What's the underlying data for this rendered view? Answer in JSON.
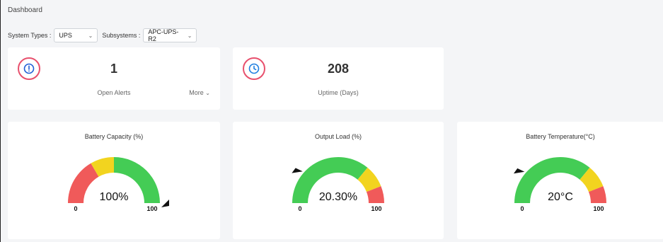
{
  "page": {
    "title": "Dashboard"
  },
  "filters": {
    "system_types_label": "System Types :",
    "system_types_value": "UPS",
    "subsystems_label": "Subsystems :",
    "subsystems_value": "APC-UPS-R2"
  },
  "stats": [
    {
      "icon": "alert-circle-icon",
      "value": "1",
      "label": "Open Alerts",
      "more_label": "More"
    },
    {
      "icon": "clock-icon",
      "value": "208",
      "label": "Uptime (Days)"
    }
  ],
  "gauges": [
    {
      "title": "Battery Capacity (%)",
      "value": 100,
      "display": "100%",
      "min": 0,
      "max": 100,
      "min_label": "0",
      "max_label": "100",
      "bands": [
        {
          "from": 0,
          "to": 33.3,
          "color": "#f05a5a"
        },
        {
          "from": 33.3,
          "to": 50,
          "color": "#f2d41f"
        },
        {
          "from": 50,
          "to": 100,
          "color": "#44cc55"
        }
      ]
    },
    {
      "title": "Output Load (%)",
      "value": 20.3,
      "display": "20.30%",
      "min": 0,
      "max": 100,
      "min_label": "0",
      "max_label": "100",
      "bands": [
        {
          "from": 0,
          "to": 72,
          "color": "#44cc55"
        },
        {
          "from": 72,
          "to": 88,
          "color": "#f2d41f"
        },
        {
          "from": 88,
          "to": 100,
          "color": "#f05a5a"
        }
      ]
    },
    {
      "title": "Battery Temperature(°C)",
      "value": 20,
      "display": "20°C",
      "min": 0,
      "max": 100,
      "min_label": "0",
      "max_label": "100",
      "bands": [
        {
          "from": 0,
          "to": 72,
          "color": "#44cc55"
        },
        {
          "from": 72,
          "to": 88,
          "color": "#f2d41f"
        },
        {
          "from": 88,
          "to": 100,
          "color": "#f05a5a"
        }
      ]
    }
  ],
  "colors": {
    "accent_ring": "#e8506d",
    "alert_icon": "#1f5fd6",
    "clock_icon": "#1f7fe0",
    "pointer": "#111111"
  }
}
